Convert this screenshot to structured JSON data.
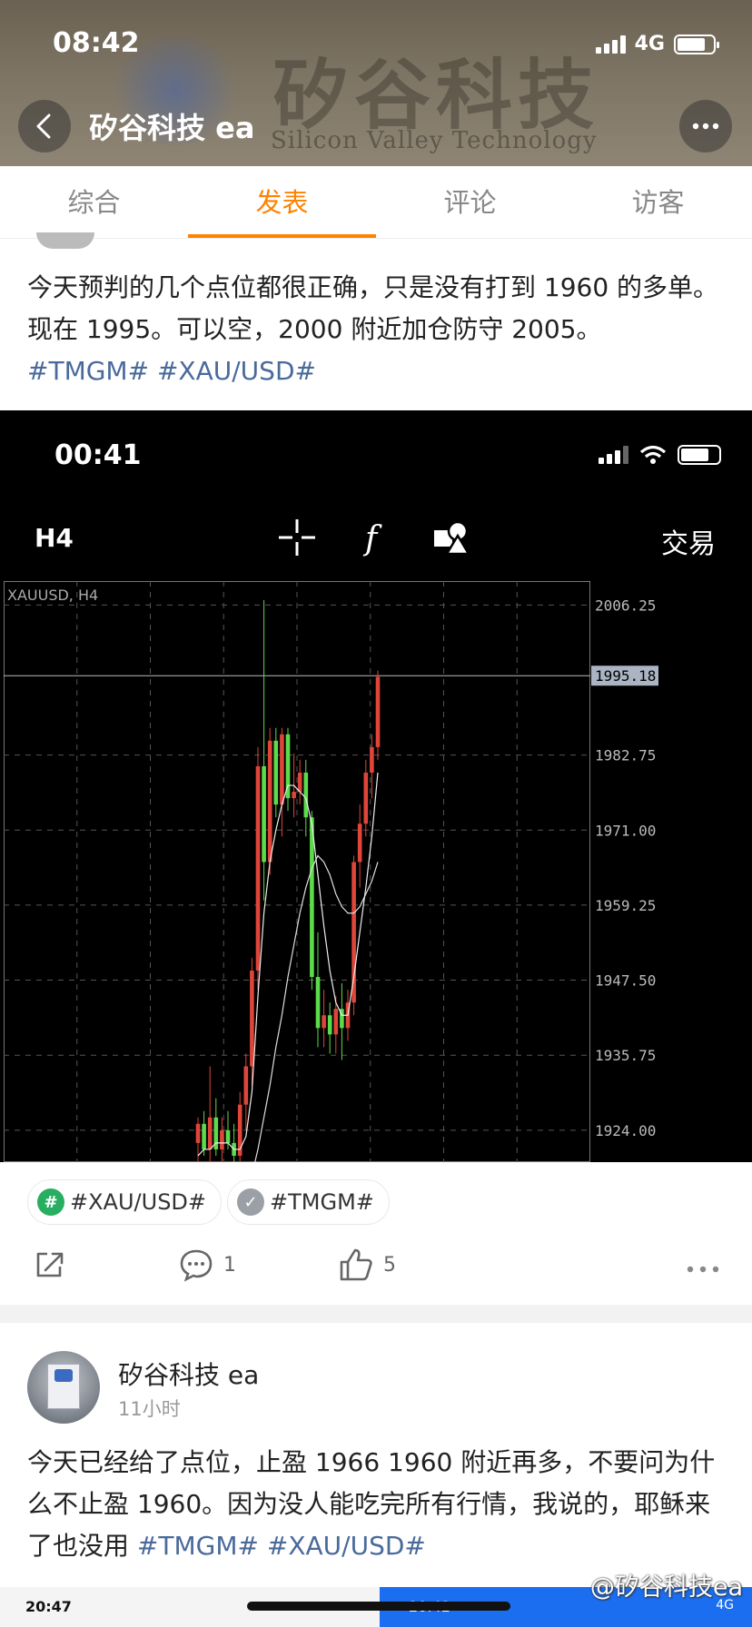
{
  "status_bar": {
    "time": "08:42",
    "network": "4G"
  },
  "header": {
    "title": "矽谷科技 ea",
    "watermark_text": "矽谷科技",
    "watermark_sub": "Silicon Valley Technology"
  },
  "tabs": [
    {
      "label": "综合",
      "active": false
    },
    {
      "label": "发表",
      "active": true
    },
    {
      "label": "评论",
      "active": false
    },
    {
      "label": "访客",
      "active": false
    }
  ],
  "post1": {
    "text": "今天预判的几个点位都很正确，只是没有打到 1960 的多单。现在 1995。可以空，2000 附近加仓防守 2005。",
    "tags": [
      "#TMGM#",
      "#XAU/USD#"
    ],
    "screenshot": {
      "time": "00:41",
      "timeframe": "H4",
      "trade_label": "交易",
      "symbol_label": "XAUUSD, H4",
      "current_price_label": "1995.18"
    },
    "chips": [
      {
        "label": "#XAU/USD#",
        "icon": "hashtag-icon",
        "color": "#27ae60"
      },
      {
        "label": "#TMGM#",
        "icon": "verified-badge-icon",
        "color": "#9aa0a6"
      }
    ],
    "actions": {
      "comments": "1",
      "likes": "5"
    }
  },
  "post2": {
    "author": "矽谷科技 ea",
    "time": "11小时",
    "text": "今天已经给了点位，止盈 1966 1960 附近再多，不要问为什么不止盈 1960。因为没人能吃完所有行情，我说的，耶稣来了也没用",
    "tags": [
      "#TMGM#",
      "#XAU/USD#"
    ]
  },
  "bottom_strip": {
    "time_left": "20:47",
    "time_right": "20:42",
    "network_right": "4G"
  },
  "watermark": "@矽谷科技ea",
  "chart_data": {
    "type": "candlestick",
    "symbol": "XAUUSD",
    "timeframe": "H4",
    "y_ticks": [
      2006.25,
      1995.18,
      1982.75,
      1971.0,
      1959.25,
      1947.5,
      1935.75,
      1924.0
    ],
    "ylim": [
      1919,
      2010
    ],
    "current_price": 1995.18,
    "up_color": "#e0453a",
    "down_color": "#5cdc4a",
    "candles": [
      {
        "o": 1922,
        "h": 1926,
        "l": 1919,
        "c": 1925
      },
      {
        "o": 1925,
        "h": 1927,
        "l": 1920,
        "c": 1921
      },
      {
        "o": 1921,
        "h": 1934,
        "l": 1919,
        "c": 1926
      },
      {
        "o": 1926,
        "h": 1929,
        "l": 1920,
        "c": 1921
      },
      {
        "o": 1921,
        "h": 1926,
        "l": 1919,
        "c": 1924
      },
      {
        "o": 1924,
        "h": 1927,
        "l": 1921,
        "c": 1922
      },
      {
        "o": 1922,
        "h": 1925,
        "l": 1919,
        "c": 1920
      },
      {
        "o": 1920,
        "h": 1930,
        "l": 1919,
        "c": 1928
      },
      {
        "o": 1928,
        "h": 1936,
        "l": 1924,
        "c": 1934
      },
      {
        "o": 1934,
        "h": 1951,
        "l": 1931,
        "c": 1949
      },
      {
        "o": 1949,
        "h": 1984,
        "l": 1946,
        "c": 1981
      },
      {
        "o": 1981,
        "h": 2007,
        "l": 1960,
        "c": 1966
      },
      {
        "o": 1966,
        "h": 1987,
        "l": 1964,
        "c": 1985
      },
      {
        "o": 1985,
        "h": 1987,
        "l": 1973,
        "c": 1975
      },
      {
        "o": 1975,
        "h": 1987,
        "l": 1970,
        "c": 1986
      },
      {
        "o": 1986,
        "h": 1987,
        "l": 1974,
        "c": 1976
      },
      {
        "o": 1976,
        "h": 1983,
        "l": 1973,
        "c": 1977
      },
      {
        "o": 1977,
        "h": 1982,
        "l": 1975,
        "c": 1980
      },
      {
        "o": 1980,
        "h": 1982,
        "l": 1970,
        "c": 1973
      },
      {
        "o": 1973,
        "h": 1974,
        "l": 1946,
        "c": 1948
      },
      {
        "o": 1948,
        "h": 1955,
        "l": 1937,
        "c": 1940
      },
      {
        "o": 1940,
        "h": 1946,
        "l": 1937,
        "c": 1942
      },
      {
        "o": 1942,
        "h": 1944,
        "l": 1936,
        "c": 1939
      },
      {
        "o": 1939,
        "h": 1945,
        "l": 1936,
        "c": 1943
      },
      {
        "o": 1943,
        "h": 1947,
        "l": 1935,
        "c": 1940
      },
      {
        "o": 1940,
        "h": 1946,
        "l": 1938,
        "c": 1944
      },
      {
        "o": 1944,
        "h": 1967,
        "l": 1942,
        "c": 1966
      },
      {
        "o": 1966,
        "h": 1975,
        "l": 1962,
        "c": 1972
      },
      {
        "o": 1972,
        "h": 1982,
        "l": 1970,
        "c": 1980
      },
      {
        "o": 1980,
        "h": 1986,
        "l": 1976,
        "c": 1984
      },
      {
        "o": 1984,
        "h": 1996,
        "l": 1982,
        "c": 1995
      }
    ],
    "ma_fast": [
      1920,
      1921,
      1921,
      1922,
      1922,
      1922,
      1921,
      1921,
      1923,
      1930,
      1945,
      1958,
      1966,
      1971,
      1975,
      1978,
      1978,
      1977,
      1976,
      1972,
      1964,
      1956,
      1949,
      1944,
      1942,
      1942,
      1948,
      1955,
      1962,
      1970,
      1980
    ],
    "ma_slow": [
      1900,
      1902,
      1904,
      1906,
      1907,
      1909,
      1910,
      1912,
      1914,
      1917,
      1921,
      1926,
      1931,
      1937,
      1942,
      1948,
      1953,
      1958,
      1962,
      1965,
      1967,
      1966,
      1964,
      1961,
      1959,
      1958,
      1958,
      1959,
      1961,
      1963,
      1966
    ]
  }
}
